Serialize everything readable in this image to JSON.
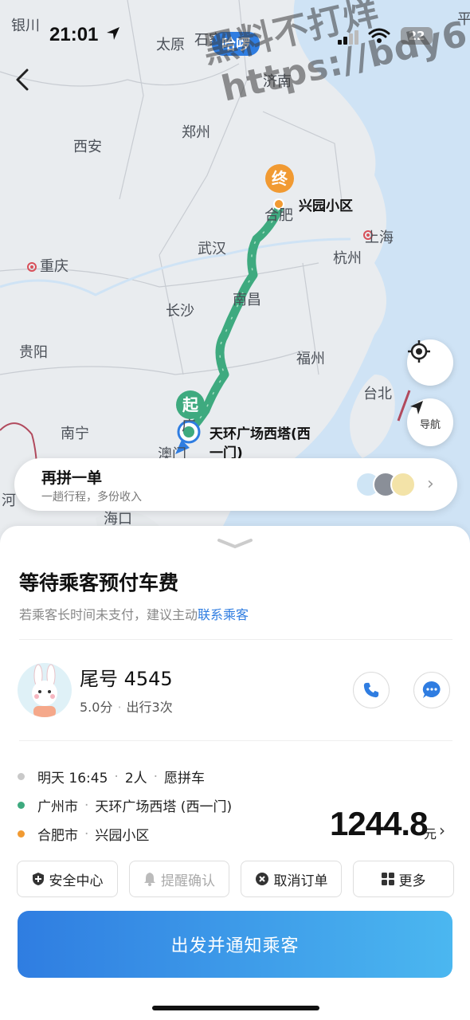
{
  "status_bar": {
    "time": "21:01",
    "center_pill": "哈啰",
    "battery": "22"
  },
  "map": {
    "cities": {
      "yinchuan": "银川",
      "taiyuan": "太原",
      "shijiazhuang": "石家庄",
      "jinan": "济南",
      "ping": "平",
      "xian": "西安",
      "zhengzhou": "郑州",
      "hefei": "合肥",
      "shanghai": "上海",
      "wuhan": "武汉",
      "hangzhou": "杭州",
      "chongqing": "重庆",
      "nanchang": "南昌",
      "changsha": "长沙",
      "guiyang": "贵阳",
      "fuzhou": "福州",
      "taipei": "台北",
      "nanning": "南宁",
      "macau": "澳门",
      "haikou": "海口",
      "he": "河"
    },
    "end_marker": "终",
    "start_marker": "起",
    "end_label": "兴园小区",
    "start_label_line1": "天环广场西塔(西",
    "start_label_line2": "一门)",
    "guangzhou_fragment": "广",
    "nav_label": "导航",
    "route_color": "#3eaa7f",
    "end_color": "#f19a32"
  },
  "watermark": {
    "line1": "黑料不打烊",
    "line2": "https://bdy6.co"
  },
  "carpool_card": {
    "title": "再拼一单",
    "subtitle": "一趟行程，多份收入"
  },
  "sheet": {
    "title": "等待乘客预付车费",
    "hint_prefix": "若乘客长时间未支付，建议主动",
    "hint_link": "联系乘客"
  },
  "passenger": {
    "name": "尾号 4545",
    "rating": "5.0分",
    "trips": "出行3次"
  },
  "trip": {
    "time": "明天 16:45",
    "people": "2人",
    "mode": "愿拼车",
    "from_city": "广州市",
    "from_place": "天环广场西塔 (西一门)",
    "to_city": "合肥市",
    "to_place": "兴园小区"
  },
  "price": {
    "amount": "1244.8",
    "unit": "元"
  },
  "actions": {
    "safety": "安全中心",
    "remind": "提醒确认",
    "cancel": "取消订单",
    "more": "更多"
  },
  "main_button": "出发并通知乘客",
  "colors": {
    "accent": "#2f7de1",
    "route": "#3eaa7f",
    "destination": "#f19a32"
  }
}
